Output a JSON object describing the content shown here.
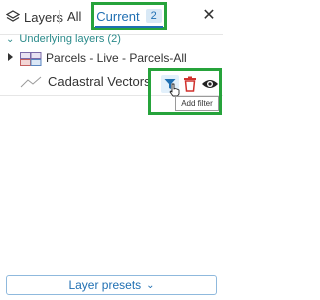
{
  "header": {
    "layers_label": "Layers",
    "tab_all_label": "All",
    "tab_current_label": "Current",
    "tab_current_count": "2",
    "close_symbol": "✕"
  },
  "group": {
    "label": "Underlying layers (2)",
    "chevron": "⌄"
  },
  "layers": [
    {
      "label": "Parcels - Live - Parcels-All",
      "icon": "polygon-swatch-icon"
    },
    {
      "label": "Cadastral Vectors",
      "icon": "line-swatch-icon"
    }
  ],
  "actions": {
    "filter_icon": "filter-icon",
    "delete_icon": "trash-icon",
    "visibility_icon": "eye-icon"
  },
  "tooltip": {
    "text": "Add filter"
  },
  "footer": {
    "presets_label": "Layer presets",
    "presets_chevron": "⌄"
  },
  "colors": {
    "accent_blue": "#1f6fb2",
    "teal": "#2a8a8a",
    "highlight_green": "#26a33b",
    "delete_red": "#d0312d"
  }
}
